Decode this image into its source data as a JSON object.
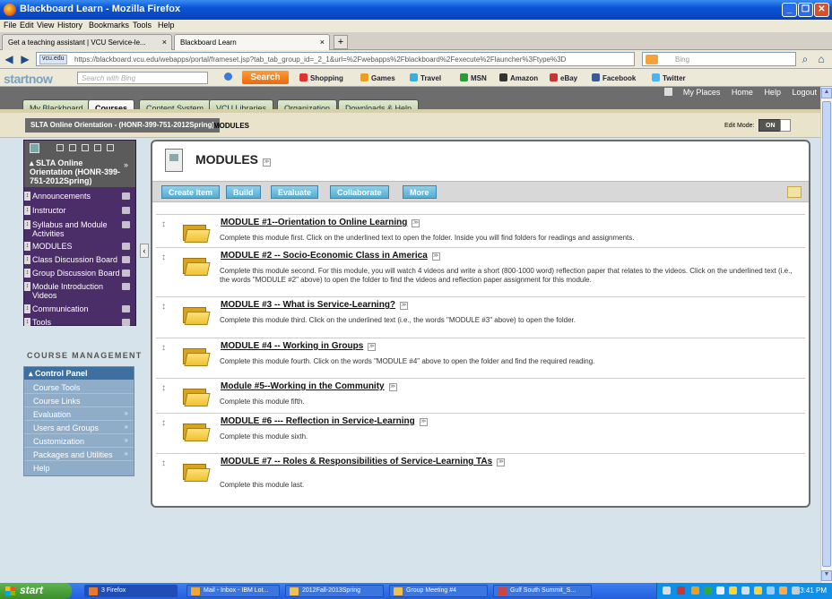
{
  "window": {
    "title": "Blackboard Learn - Mozilla Firefox"
  },
  "menubar": [
    "File",
    "Edit",
    "View",
    "History",
    "Bookmarks",
    "Tools",
    "Help"
  ],
  "browser_tabs": [
    {
      "label": "Get a teaching assistant | VCU Service-le..."
    },
    {
      "label": "Blackboard Learn"
    }
  ],
  "address": {
    "domain": "vcu.edu",
    "url": "https://blackboard.vcu.edu/webapps/portal/frameset.jsp?tab_tab_group_id=_2_1&url=%2Fwebapps%2Fblackboard%2Fexecute%2Flauncher%3Ftype%3D",
    "search_placeholder": "Bing"
  },
  "toolbar": {
    "brand": "startnow",
    "search_placeholder": "Search with Bing",
    "search_button": "Search",
    "links": [
      "Shopping",
      "Games",
      "Travel",
      "MSN",
      "Amazon",
      "eBay",
      "Facebook",
      "Twitter"
    ]
  },
  "util_nav": [
    "My Places",
    "Home",
    "Help",
    "Logout"
  ],
  "course_tabs": [
    "My Blackboard",
    "Courses",
    "Content System",
    "VCU Libraries",
    "Organization",
    "Downloads & Help"
  ],
  "breadcrumb": {
    "course": "SLTA Online Orientation - (HONR-399-751-2012Spring)",
    "page": "MODULES"
  },
  "edit_mode": {
    "label": "Edit Mode:",
    "state": "ON"
  },
  "course_menu": {
    "title": "SLTA Online Orientation (HONR-399-751-2012Spring)",
    "items": [
      "Announcements",
      "Instructor",
      "Syllabus and Module Activities",
      "MODULES",
      "Class Discussion Board",
      "Group Discussion Board",
      "Module Introduction Videos",
      "Communication",
      "Tools"
    ]
  },
  "course_management": {
    "heading": "COURSE MANAGEMENT",
    "panel_title": "Control Panel",
    "items": [
      "Course Tools",
      "Course Links",
      "Evaluation",
      "Users and Groups",
      "Customization",
      "Packages and Utilities",
      "Help"
    ]
  },
  "content": {
    "title": "MODULES",
    "actions": [
      "Create Item",
      "Build",
      "Evaluate",
      "Collaborate",
      "More"
    ],
    "modules": [
      {
        "title": "MODULE #1--Orientation to Online Learning",
        "desc": "Complete this module first.  Click on the underlined text to open the folder.  Inside you will find folders for readings and assignments."
      },
      {
        "title": "MODULE #2 -- Socio-Economic Class in America",
        "desc": "Complete this module second. For this module, you will watch 4 videos and write a short (800-1000 word) reflection paper that relates to the videos. Click on the underlined text (i.e., the words \"MODULE #2\" above) to open the folder to find the videos and reflection paper assignment for this module."
      },
      {
        "title": "MODULE #3 -- What is Service-Learning?",
        "desc": "Complete this module third. Click on the underlined text (i.e., the words \"MODULE #3\" above) to open the folder."
      },
      {
        "title": "MODULE #4 -- Working in Groups",
        "desc": "Complete this module fourth. Click on the words \"MODULE #4\" above to open the folder and find the required reading."
      },
      {
        "title": "Module #5--Working in the Community",
        "desc": "Complete this module fifth."
      },
      {
        "title": "MODULE #6 --- Reflection in Service-Learning",
        "desc": "Complete this module sixth."
      },
      {
        "title": "MODULE #7 -- Roles & Responsibilities of Service-Learning TAs",
        "desc": "Complete this module last."
      }
    ]
  },
  "taskbar": {
    "start": "start",
    "tasks": [
      "3 Firefox",
      "Mail - Inbox - IBM Lot...",
      "2012Fall-2013Spring",
      "Group Meeting #4",
      "Gulf South Summit_S..."
    ],
    "clock": "3:41 PM"
  }
}
